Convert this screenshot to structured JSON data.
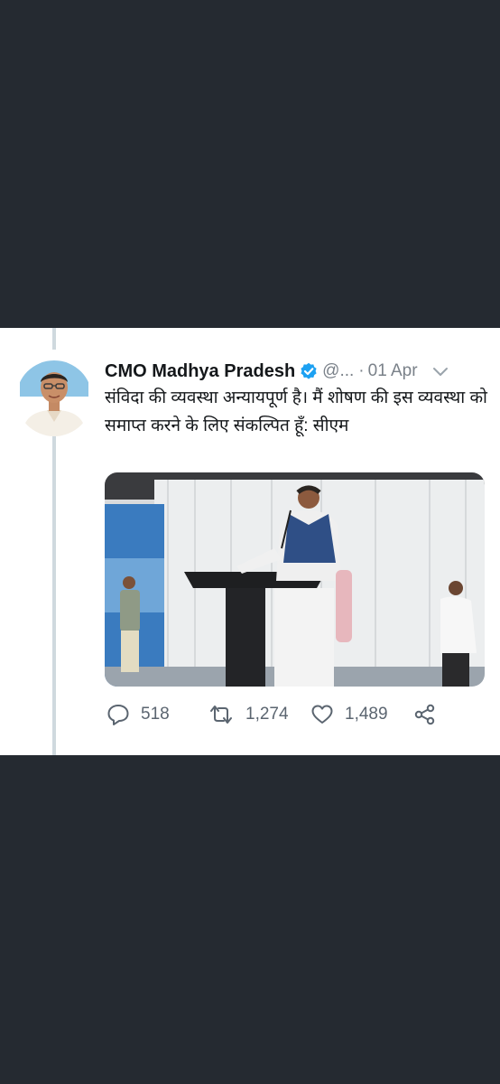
{
  "tweet": {
    "display_name": "CMO Madhya Pradesh",
    "handle": "@...",
    "separator": "·",
    "date": "01 Apr",
    "text": "संविदा की व्यवस्था अन्यायपूर्ण है। मैं शोषण की इस व्यवस्था को समाप्त करने के लिए संकल्पित हूँ: सीएम",
    "verified": true
  },
  "actions": {
    "replies": "518",
    "retweets": "1,274",
    "likes": "1,489"
  },
  "icons": {
    "verified": "verified-badge-icon",
    "more": "chevron-down-icon",
    "reply": "reply-icon",
    "retweet": "retweet-icon",
    "like": "heart-icon",
    "share": "share-icon"
  },
  "colors": {
    "background": "#252a31",
    "card": "#ffffff",
    "verified": "#1da1f2",
    "muted_text": "#7a8189"
  }
}
